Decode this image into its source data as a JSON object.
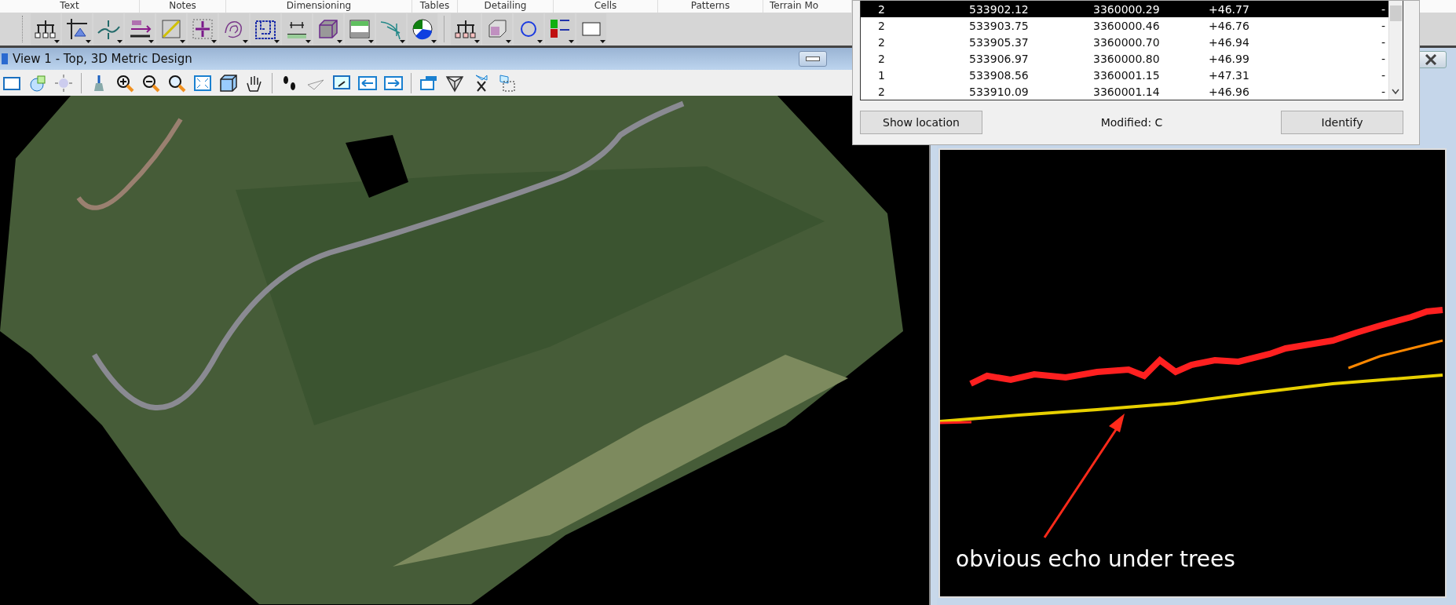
{
  "ribbon": {
    "groups": [
      "Text",
      "Notes",
      "Dimensioning",
      "Tables",
      "Detailing",
      "Cells",
      "Patterns",
      "Terrain Mo"
    ]
  },
  "view_window": {
    "title": "View 1 - Top, 3D Metric Design"
  },
  "dialog": {
    "rows": [
      {
        "cells": [
          "2",
          "533902.12",
          "3360000.29",
          "+46.77",
          "-"
        ],
        "selected": true
      },
      {
        "cells": [
          "2",
          "533903.75",
          "3360000.46",
          "+46.76",
          "-"
        ],
        "selected": false
      },
      {
        "cells": [
          "2",
          "533905.37",
          "3360000.70",
          "+46.94",
          "-"
        ],
        "selected": false
      },
      {
        "cells": [
          "2",
          "533906.97",
          "3360000.80",
          "+46.99",
          "-"
        ],
        "selected": false
      },
      {
        "cells": [
          "1",
          "533908.56",
          "3360001.15",
          "+47.31",
          "-"
        ],
        "selected": false
      },
      {
        "cells": [
          "2",
          "533910.09",
          "3360001.14",
          "+46.96",
          "-"
        ],
        "selected": false
      }
    ],
    "show_button": "Show location",
    "modified": "Modified: C",
    "identify_button": "Identify"
  },
  "profile_view": {
    "annotation": "obvious echo under trees"
  }
}
